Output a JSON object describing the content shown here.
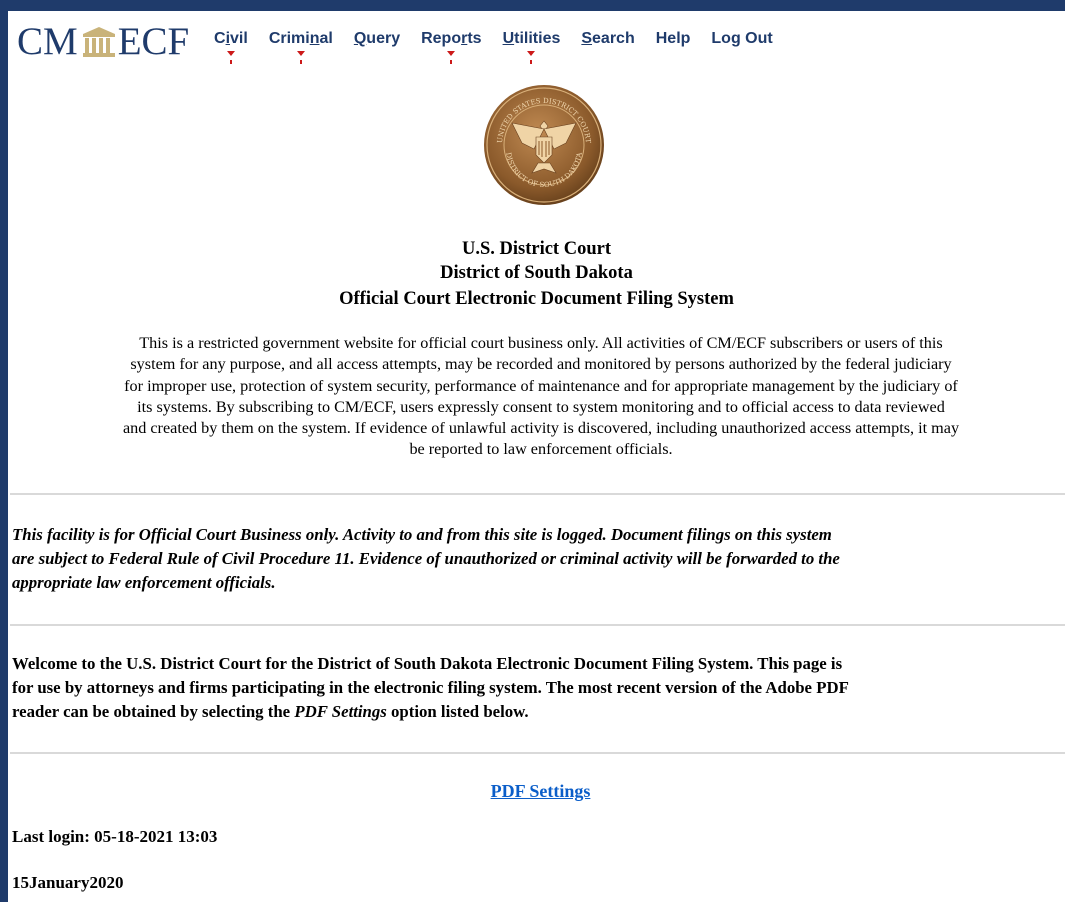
{
  "logo": {
    "left": "CM",
    "right": "ECF"
  },
  "menu": [
    {
      "pre": "C",
      "ul": "i",
      "post": "vil",
      "dropdown": true
    },
    {
      "pre": "Crimi",
      "ul": "n",
      "post": "al",
      "dropdown": true
    },
    {
      "pre": "",
      "ul": "Q",
      "post": "uery",
      "dropdown": false
    },
    {
      "pre": "Repo",
      "ul": "r",
      "post": "ts",
      "dropdown": true
    },
    {
      "pre": "",
      "ul": "U",
      "post": "tilities",
      "dropdown": true
    },
    {
      "pre": "",
      "ul": "S",
      "post": "earch",
      "dropdown": false
    },
    {
      "pre": "Help",
      "ul": "",
      "post": "",
      "dropdown": false
    },
    {
      "pre": "Log Out",
      "ul": "",
      "post": "",
      "dropdown": false
    }
  ],
  "seal": {
    "top_text": "UNITED STATES DISTRICT COURT",
    "bottom_text": "DISTRICT OF SOUTH DAKOTA"
  },
  "heading": {
    "line1": "U.S. District Court",
    "line2": "District of South Dakota",
    "line3": "Official Court Electronic Document Filing System"
  },
  "notice": {
    "line1": "This is a restricted government website for official court business only. All activities of CM/ECF subscribers or users of this",
    "line2": "system for any purpose, and all access attempts, may be recorded and monitored by persons authorized by the federal judiciary",
    "line3": "for improper use, protection of system security, performance of maintenance and for appropriate management by the judiciary of",
    "line4": "its systems. By subscribing to CM/ECF, users expressly consent to system monitoring and to official access to data reviewed",
    "line5": "and created by them on the system. If evidence of unlawful activity is discovered, including unauthorized access attempts, it may",
    "line6": "be reported to law enforcement officials."
  },
  "official_notice": {
    "line1": "This facility is for Official Court Business only. Activity to and from this site is logged. Document filings on this system",
    "line2": "are subject to Federal Rule of Civil Procedure 11. Evidence of unauthorized or criminal activity will be forwarded to the",
    "line3": "appropriate law enforcement officials."
  },
  "welcome": {
    "line1": "Welcome to the U.S. District Court for the District of South Dakota Electronic Document Filing System. This page is",
    "line2": "for use by attorneys and firms participating in the electronic filing system. The most recent version of the Adobe PDF",
    "line3_pre": "reader can be obtained by selecting the ",
    "line3_em": "PDF Settings",
    "line3_post": " option listed below."
  },
  "pdf_link": "PDF Settings",
  "last_login": "Last login: 05-18-2021 13:03",
  "date": "15January2020",
  "colors": {
    "frame": "#1f3b6b",
    "menu_text": "#1f3b6b",
    "caret": "#cc1a1a",
    "link": "#0b5ec9",
    "rule": "#d9d9d9",
    "seal": "#8b5a2b"
  }
}
